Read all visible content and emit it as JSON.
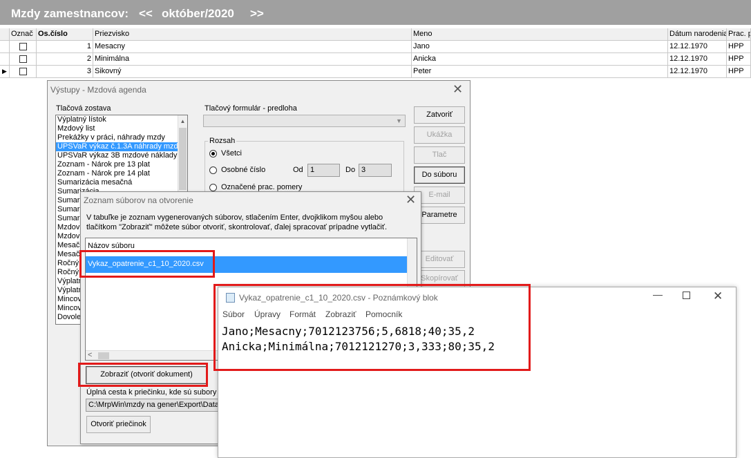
{
  "header": {
    "title": "Mzdy zamestnancov:",
    "prev": "<<",
    "period": "október/2020",
    "next": ">>"
  },
  "grid": {
    "columns": [
      "Označ",
      "Os.číslo",
      "Priezvisko",
      "Meno",
      "Dátum narodenia",
      "Prac. p"
    ],
    "rows": [
      {
        "id": "1",
        "surname": "Mesacny",
        "name": "Jano",
        "birth": "12.12.1970",
        "type": "HPP"
      },
      {
        "id": "2",
        "surname": "Minimálna",
        "name": "Anicka",
        "birth": "12.12.1970",
        "type": "HPP"
      },
      {
        "id": "3",
        "surname": "Sikovný",
        "name": "Peter",
        "birth": "12.12.1970",
        "type": "HPP"
      }
    ]
  },
  "outputs": {
    "title": "Výstupy - Mzdová agenda",
    "report_label": "Tlačová zostava",
    "reports": [
      "Výplatný lístok",
      "Mzdový list",
      "Prekážky v práci, náhrady mzdy",
      "UPSVaR výkaz č.1.3A náhrady mzdy",
      "UPSVaR výkaz 3B mzdové náklady",
      "Zoznam - Nárok pre 13 plat",
      "Zoznam - Nárok pre 14 plat",
      "Sumarizácia mesačná",
      "Sumarizácia",
      "Sumari",
      "Sumari",
      "Sumari",
      "Mzdov",
      "Mzdov",
      "Mesač",
      "Mesač",
      "Ročný",
      "Ročný",
      "Výplatn",
      "Výplatn",
      "Mincov",
      "Mincov",
      "Dovole"
    ],
    "form_label": "Tlačový formulár - predloha",
    "range_label": "Rozsah",
    "radio_all": "Všetci",
    "radio_personal": "Osobné číslo",
    "radio_marked": "Označené prac. pomery",
    "from_label": "Od",
    "from_value": "1",
    "to_label": "Do",
    "to_value": "3",
    "buttons": {
      "close": "Zatvoriť",
      "preview": "Ukážka",
      "print": "Tlač",
      "to_file": "Do súboru",
      "email": "E-mail",
      "params": "Parametre",
      "edit": "Editovať",
      "copy": "Skopírovať"
    }
  },
  "files": {
    "title": "Zoznam súborov na otvorenie",
    "info": "V tabuľke je zoznam vygenerovaných súborov, stlačením Enter, dvojklikom myšou alebo tlačítkom \"Zobraziť\" môžete súbor otvoriť, skontrolovať, ďalej spracovať prípadne vytlačiť.",
    "column": "Názov súboru",
    "file": "Vykaz_opatrenie_c1_10_2020.csv",
    "show_button": "Zobraziť (otvoriť dokument)",
    "path_label": "Úplná cesta k priečinku, kde sú subory u",
    "path_value": "C:\\MrpWin\\mzdy na gener\\Export\\Data",
    "open_folder": "Otvoriť priečinok"
  },
  "notepad": {
    "title": "Vykaz_opatrenie_c1_10_2020.csv - Poznámkový blok",
    "menu": [
      "Súbor",
      "Úpravy",
      "Formát",
      "Zobraziť",
      "Pomocník"
    ],
    "lines": [
      "Jano;Mesacny;7012123756;5,6818;40;35,2",
      "Anicka;Minimálna;7012121270;3,333;80;35,2"
    ]
  },
  "colors": {
    "highlight_red": "#e21a1a",
    "selection_blue": "#3399ff",
    "titlebar_gray": "#a0a0a0"
  }
}
